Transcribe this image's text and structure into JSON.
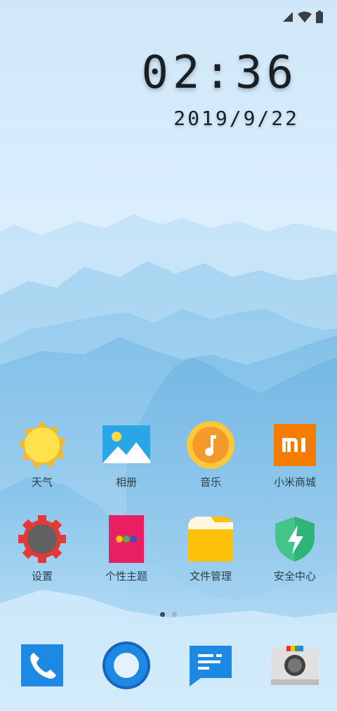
{
  "status_bar": {
    "icons": [
      "signal-icon",
      "wifi-icon",
      "battery-icon"
    ]
  },
  "lock_clock": {
    "time": "02:36",
    "date": "2019/9/22"
  },
  "home_apps": [
    {
      "label": "天气",
      "icon": "weather-icon"
    },
    {
      "label": "相册",
      "icon": "gallery-icon"
    },
    {
      "label": "音乐",
      "icon": "music-icon"
    },
    {
      "label": "小米商城",
      "icon": "mi-store-icon"
    },
    {
      "label": "设置",
      "icon": "settings-icon"
    },
    {
      "label": "个性主题",
      "icon": "themes-icon"
    },
    {
      "label": "文件管理",
      "icon": "file-manager-icon"
    },
    {
      "label": "安全中心",
      "icon": "security-icon"
    }
  ],
  "page_indicator": {
    "pages": 2,
    "current": 1
  },
  "dock": [
    {
      "icon": "phone-icon"
    },
    {
      "icon": "browser-icon"
    },
    {
      "icon": "messages-icon"
    },
    {
      "icon": "camera-icon"
    }
  ],
  "colors": {
    "sky_top": "#d7ecfa",
    "sky_bottom": "#cfe6f6",
    "mountain": "#8fc6ea"
  }
}
